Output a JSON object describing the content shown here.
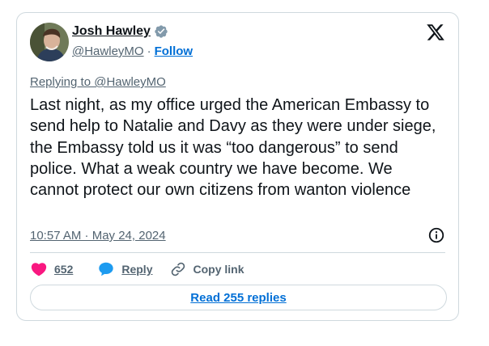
{
  "author": {
    "name": "Josh Hawley",
    "handle": "@HawleyMO",
    "separator": "·",
    "follow_label": "Follow"
  },
  "replying_to": "Replying to @HawleyMO",
  "tweet_text": "Last night, as my office urged the American Embassy to send help to Natalie and Davy as they were under siege, the Embassy told us it was “too dangerous” to send police. What a weak country we have become. We cannot protect our own citizens from wanton violence",
  "timestamp": "10:57 AM · May 24, 2024",
  "actions": {
    "like_count": "652",
    "reply_label": "Reply",
    "copy_link_label": "Copy link"
  },
  "read_replies_label": "Read 255 replies",
  "colors": {
    "like": "#f91880",
    "reply": "#1d9bf0",
    "link": "#006fd6",
    "verified": "#829aab",
    "muted": "#536471",
    "border": "#cfd9de"
  },
  "icons": {
    "logo": "x-logo-icon",
    "verified": "verified-badge-icon",
    "info": "info-icon",
    "like": "heart-icon",
    "reply": "speech-bubble-icon",
    "copy_link": "link-icon"
  }
}
